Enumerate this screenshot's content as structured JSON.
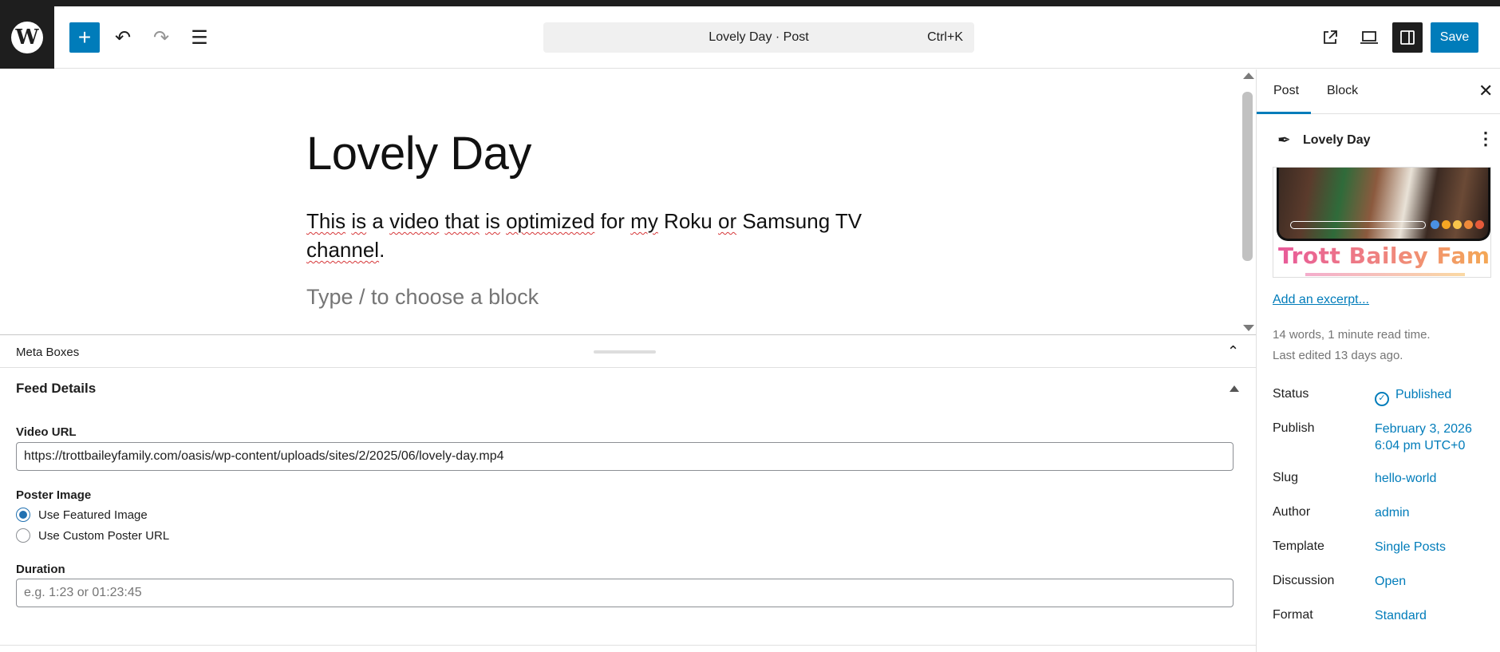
{
  "toolbar": {
    "logo_glyph": "W",
    "add_glyph": "+",
    "undo_glyph": "↶",
    "redo_glyph": "↷",
    "list_view_glyph": "☰",
    "command_title": "Lovely Day · Post",
    "command_shortcut": "Ctrl+K",
    "save_label": "Save"
  },
  "editor": {
    "title": "Lovely Day",
    "paragraph_parts": [
      "This",
      " ",
      "is",
      " a ",
      "video",
      " ",
      "that",
      " ",
      "is",
      " ",
      "optimized",
      " for ",
      "my",
      " Roku ",
      "or",
      " Samsung TV ",
      "channel",
      "."
    ],
    "block_placeholder": "Type / to choose a block"
  },
  "meta_boxes": {
    "label": "Meta Boxes",
    "collapse_glyph": "⌃"
  },
  "feed_details": {
    "title": "Feed Details",
    "video_url_label": "Video URL",
    "video_url_value": "https://trottbaileyfamily.com/oasis/wp-content/uploads/sites/2/2025/06/lovely-day.mp4",
    "poster_label": "Poster Image",
    "poster_options": [
      "Use Featured Image",
      "Use Custom Poster URL"
    ],
    "poster_selected": 0,
    "duration_label": "Duration",
    "duration_placeholder": "e.g. 1:23 or 01:23:45"
  },
  "sidebar": {
    "tabs": [
      "Post",
      "Block"
    ],
    "active_tab": "Post",
    "close_glyph": "✕",
    "post_name": "Lovely Day",
    "post_icon_glyph": "✒",
    "kebab_glyph": "⋮",
    "featured_brand_text": "Trott Bailey Family",
    "excerpt_link": "Add an excerpt...",
    "word_count": "14 words, 1 minute read time.",
    "last_edited": "Last edited 13 days ago.",
    "rows": [
      {
        "label": "Status",
        "value": "Published"
      },
      {
        "label": "Publish",
        "value": "February 3, 2026",
        "value2": "6:04 pm UTC+0"
      },
      {
        "label": "Slug",
        "value": "hello-world"
      },
      {
        "label": "Author",
        "value": "admin"
      },
      {
        "label": "Template",
        "value": "Single Posts"
      },
      {
        "label": "Discussion",
        "value": "Open"
      },
      {
        "label": "Format",
        "value": "Standard"
      }
    ],
    "status_check_glyph": "✓"
  },
  "colors": {
    "accent": "#007cba",
    "dark": "#1e1e1e",
    "spellcheck": "#d63638"
  }
}
